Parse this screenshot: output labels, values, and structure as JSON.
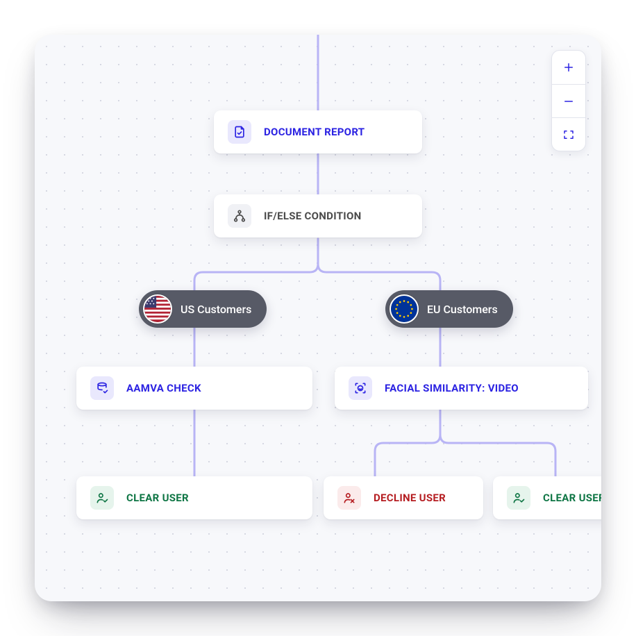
{
  "zoom_tooltip": {
    "in": "Zoom in",
    "out": "Zoom out",
    "fit": "Fit to screen"
  },
  "nodes": {
    "document_report": {
      "label": "DOCUMENT REPORT",
      "type": "report",
      "icon": "document-check-icon",
      "color": "accent"
    },
    "condition": {
      "label": "IF/ELSE CONDITION",
      "type": "condition",
      "icon": "branch-icon",
      "color": "muted"
    },
    "aamva": {
      "label": "AAMVA CHECK",
      "type": "check",
      "icon": "database-check-icon",
      "color": "accent"
    },
    "facial": {
      "label": "FACIAL SIMILARITY: VIDEO",
      "type": "check",
      "icon": "face-scan-icon",
      "color": "accent"
    },
    "clear_us": {
      "label": "CLEAR USER",
      "type": "outcome",
      "icon": "user-check-icon",
      "color": "green"
    },
    "decline_eu": {
      "label": "DECLINE USER",
      "type": "outcome",
      "icon": "user-x-icon",
      "color": "red"
    },
    "clear_eu": {
      "label": "CLEAR USER",
      "type": "outcome",
      "icon": "user-check-icon",
      "color": "green"
    }
  },
  "branches": {
    "us": {
      "label": "US Customers",
      "flag": "us"
    },
    "eu": {
      "label": "EU Customers",
      "flag": "eu"
    }
  },
  "colors": {
    "accent": "#2B22E2",
    "connector": "#B8B4F5",
    "green": "#0E7544",
    "red": "#B51D21",
    "pill": "#575A66"
  }
}
